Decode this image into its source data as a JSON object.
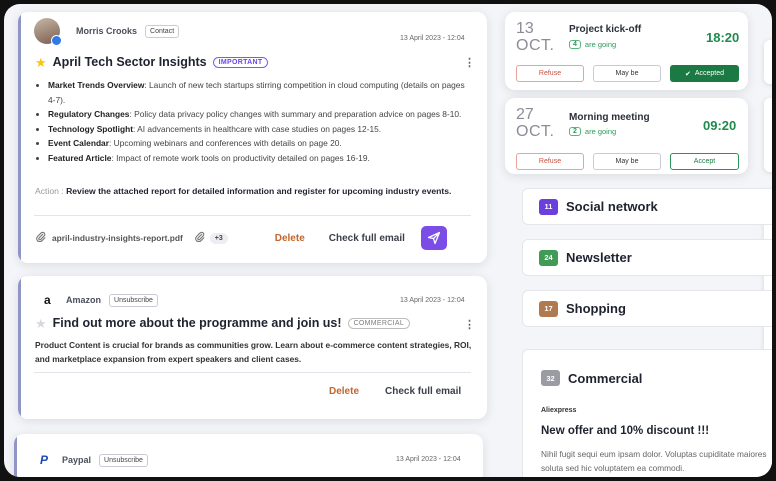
{
  "emails": [
    {
      "sender": "Morris Crooks",
      "sender_tag": "Contact",
      "date": "13 April 2023 - 12:04",
      "title": "April Tech Sector Insights",
      "badge": "IMPORTANT",
      "bullets": [
        {
          "label": "Market Trends Overview",
          "text": ": Launch of new tech startups stirring competition in cloud computing (details on pages 4-7)."
        },
        {
          "label": "Regulatory Changes",
          "text": ": Policy data privacy policy changes with summary and preparation advice on pages 8-10."
        },
        {
          "label": "Technology Spotlight",
          "text": ": AI advancements in healthcare with case studies on pages 12-15."
        },
        {
          "label": "Event Calendar",
          "text": ": Upcoming webinars and conferences with details on page 20."
        },
        {
          "label": "Featured Article",
          "text": ": Impact of remote work tools on productivity detailed on pages 16-19."
        }
      ],
      "action_label": "Action :",
      "action_text": "Review the attached report for detailed information and register for upcoming industry events.",
      "attachment": "april-industry-insights-report.pdf",
      "extra_attachments": "+3",
      "delete_label": "Delete",
      "check_label": "Check full email"
    },
    {
      "sender": "Amazon",
      "sender_tag": "Unsubscribe",
      "date": "13 April 2023 - 12:04",
      "title": "Find out more about the programme and join us!",
      "badge": "COMMERCIAL",
      "body": "Product Content is crucial for brands as communities grow. Learn about e-commerce content strategies, ROI, and marketplace expansion from expert speakers and client cases.",
      "delete_label": "Delete",
      "check_label": "Check full email"
    },
    {
      "sender": "Paypal",
      "sender_tag": "Unsubscribe",
      "date": "13 April 2023 - 12:04"
    }
  ],
  "events": [
    {
      "day": "13",
      "month": "OCT.",
      "title": "Project kick-off",
      "going_count": "4",
      "going_label": "are going",
      "time": "18:20",
      "refuse": "Refuse",
      "maybe": "May be",
      "accept": "Accepted",
      "accepted": true
    },
    {
      "day": "27",
      "month": "OCT.",
      "title": "Morning meeting",
      "going_count": "2",
      "going_label": "are going",
      "time": "09:20",
      "refuse": "Refuse",
      "maybe": "May be",
      "accept": "Accept",
      "accepted": false
    }
  ],
  "folders": [
    {
      "count": "11",
      "name": "Social network",
      "color": "#6a3fdc"
    },
    {
      "count": "24",
      "name": "Newsletter",
      "color": "#3f9b56"
    },
    {
      "count": "17",
      "name": "Shopping",
      "color": "#b07a4e"
    },
    {
      "count": "32",
      "name": "Commercial",
      "color": "#9a9ca3"
    }
  ],
  "commercial_preview": {
    "source": "Aliexpress",
    "title": "New offer and 10% discount !!!",
    "text": "Nihil fugit sequi eum ipsam dolor. Voluptas cupiditate maiores soluta sed hic voluptatem ea commodi."
  },
  "colors": {
    "accent": "#7c4ce6",
    "important": "#6b46e5",
    "success": "#1b7a43",
    "danger": "#c6533f"
  }
}
